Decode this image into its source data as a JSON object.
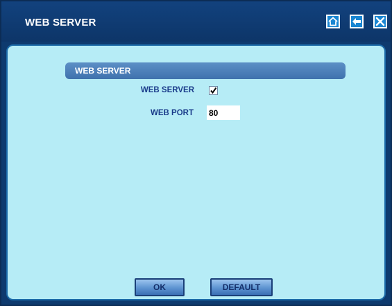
{
  "window": {
    "title": "WEB SERVER"
  },
  "titlebar_buttons": [
    {
      "name": "home-icon"
    },
    {
      "name": "back-arrow-icon"
    },
    {
      "name": "close-icon"
    }
  ],
  "section": {
    "title": "WEB SERVER"
  },
  "form": {
    "web_server_label": "WEB SERVER",
    "web_server_checked": true,
    "web_port_label": "WEB PORT",
    "web_port_value": "80"
  },
  "buttons": {
    "ok_label": "OK",
    "default_label": "DEFAULT"
  },
  "colors": {
    "titlebar": "#0e3a6e",
    "panel": "#b6ecf6",
    "accent": "#1a86d2"
  }
}
